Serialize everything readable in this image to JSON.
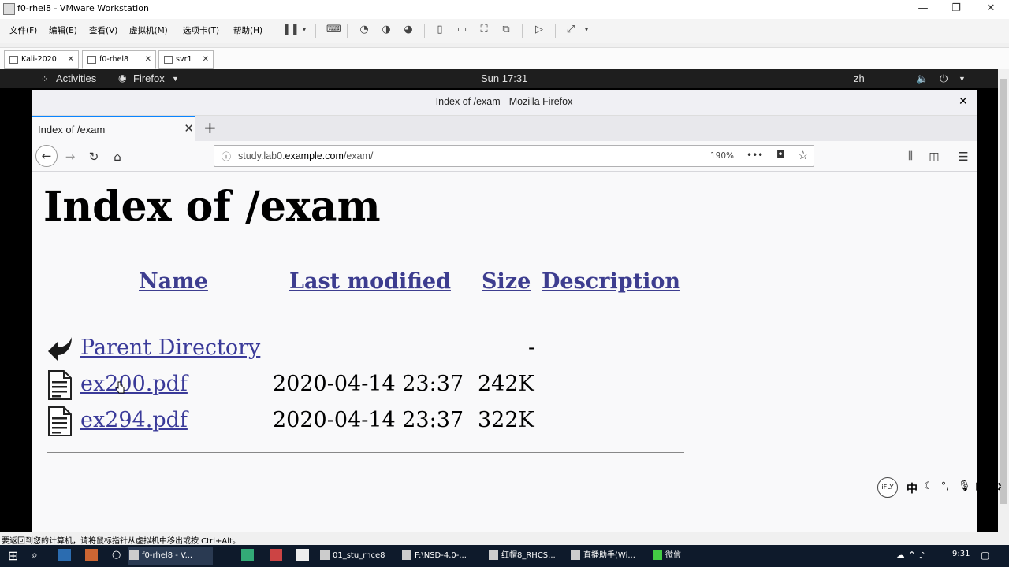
{
  "vmware": {
    "title": "f0-rhel8 - VMware Workstation",
    "menu": [
      "文件(F)",
      "编辑(E)",
      "查看(V)",
      "虚拟机(M)",
      "选项卡(T)",
      "帮助(H)"
    ],
    "tabs": [
      "Kali-2020",
      "f0-rhel8",
      "svr1"
    ],
    "status_text": "要返回到您的计算机，请将鼠标指针从虚拟机中移出或按 Ctrl+Alt。"
  },
  "gnome": {
    "activities": "Activities",
    "app": "Firefox",
    "clock": "Sun 17:31",
    "lang": "zh"
  },
  "firefox": {
    "window_title": "Index of /exam - Mozilla Firefox",
    "tab_label": "Index of /exam",
    "url_prefix": "study.lab0.",
    "url_host": "example.com",
    "url_path": "/exam/",
    "zoom": "190%"
  },
  "page": {
    "heading": "Index of /exam",
    "columns": [
      "Name",
      "Last modified",
      "Size",
      "Description"
    ],
    "rows": [
      {
        "name": "Parent Directory",
        "modified": "",
        "size": "-",
        "icon": "back-icon"
      },
      {
        "name": "ex200.pdf",
        "modified": "2020-04-14 23:37",
        "size": "242K",
        "icon": "document-icon"
      },
      {
        "name": "ex294.pdf",
        "modified": "2020-04-14 23:37",
        "size": "322K",
        "icon": "document-icon"
      }
    ]
  },
  "ime": {
    "logo": "iFLY",
    "lang": "中"
  },
  "taskbar": {
    "items": [
      "f0-rhel8 - V...",
      "01_stu_rhce8",
      "F:\\NSD-4.0-...",
      "红帽8_RHCS...",
      "直播助手(Wi...",
      "微信"
    ],
    "clock": "9:31"
  }
}
